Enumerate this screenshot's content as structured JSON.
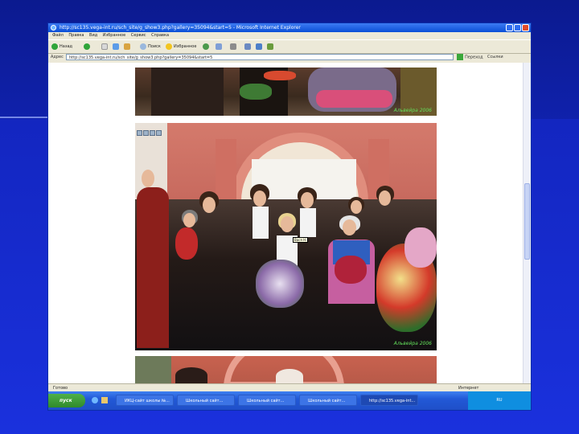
{
  "browser": {
    "title": "http://sc135.vega-int.ru/sch_site/g_show3.php?gallery=35094&start=5 - Microsoft Internet Explorer",
    "menu": [
      "Файл",
      "Правка",
      "Вид",
      "Избранное",
      "Сервис",
      "Справка"
    ],
    "toolbar": {
      "back": "Назад",
      "search": "Поиск",
      "favorites": "Избранное"
    },
    "address_label": "Адрес",
    "address": "http://sc135.vega-int.ru/sch_site/g_show3.php?gallery=35094&start=5",
    "go": "Переход",
    "links": "Ссылки"
  },
  "content": {
    "caption_top": "Альвейра 2006",
    "caption_main": "Альвейра 2006",
    "tooltip": "Вася Н."
  },
  "status": {
    "left": "Готово",
    "zone": "Интернет"
  },
  "taskbar": {
    "start": "пуск",
    "tasks": [
      "ИКЦ-сайт школы №...",
      "Школьный сайт...",
      "Школьный сайт...",
      "Школьный сайт...",
      "http://sc135.vega-int..."
    ],
    "tray": "RU"
  }
}
